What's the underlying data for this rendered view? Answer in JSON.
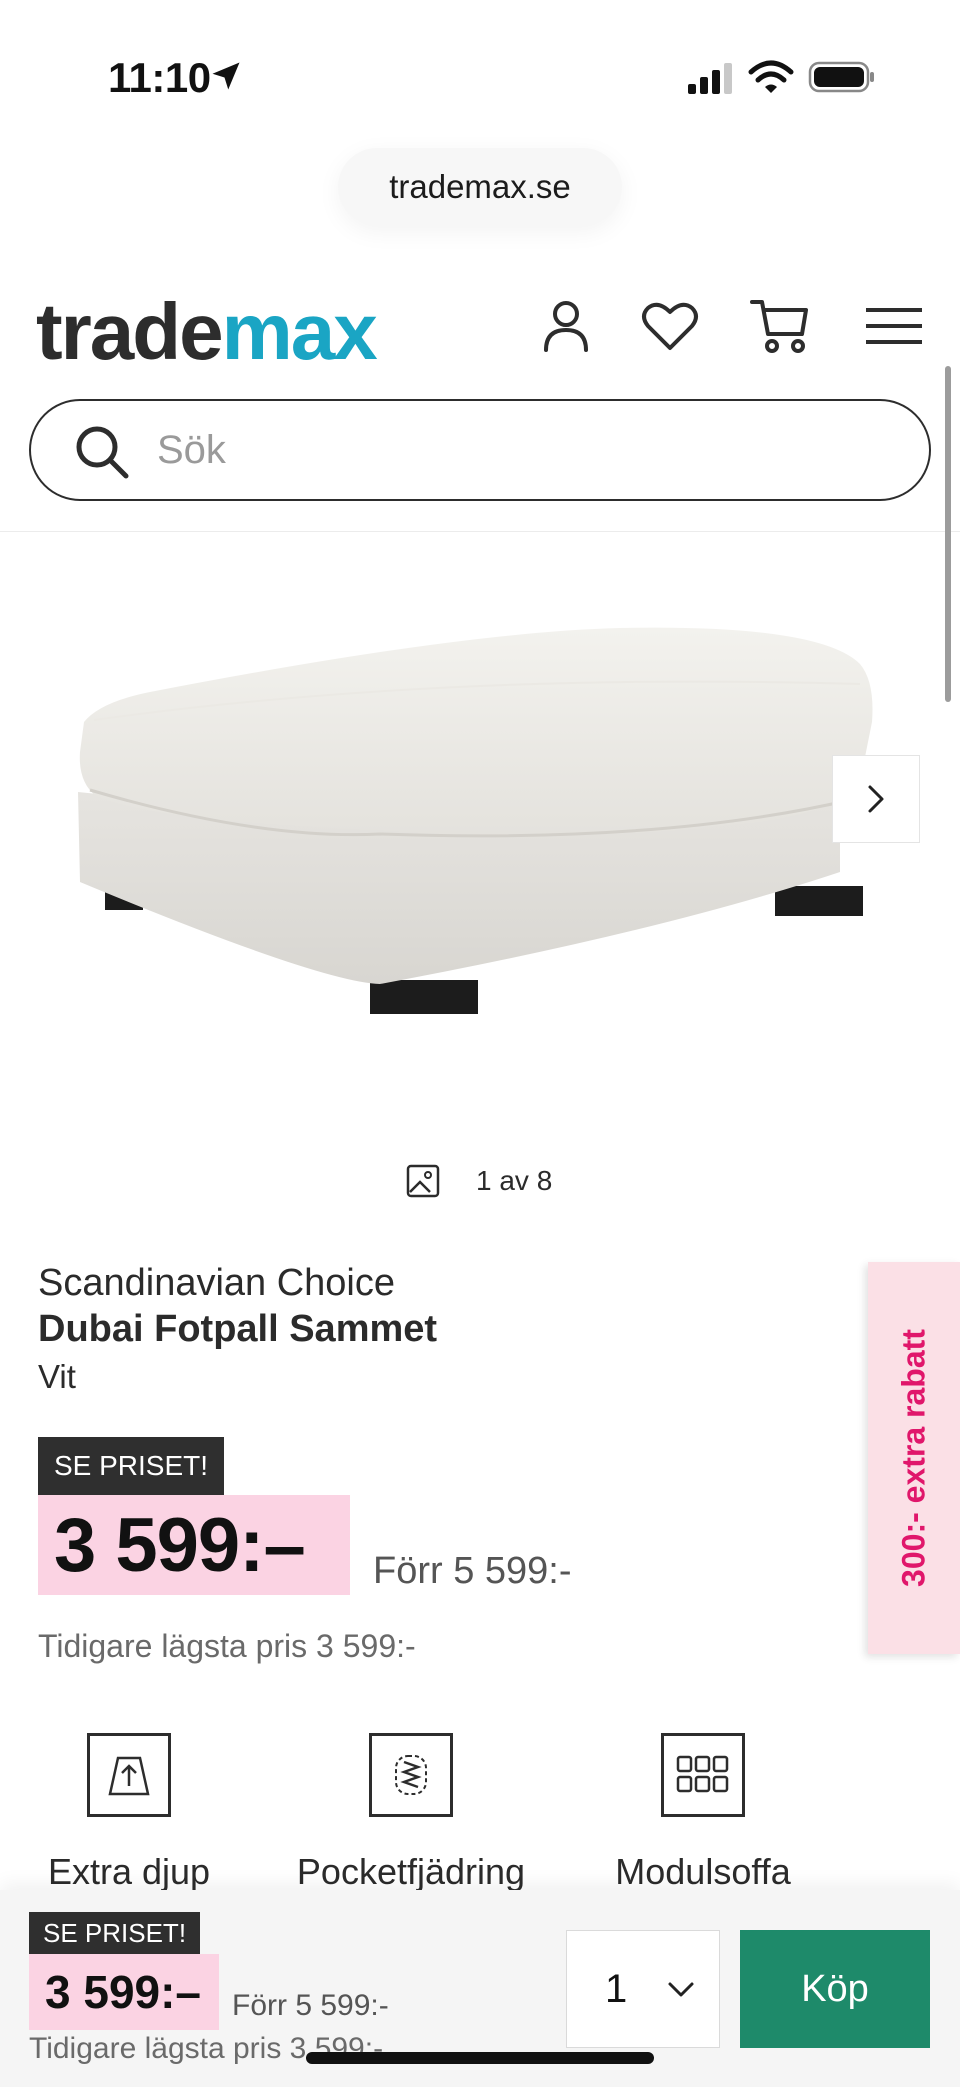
{
  "status_bar": {
    "time": "11:10"
  },
  "browser": {
    "url": "trademax.se"
  },
  "header": {
    "logo_part1": "trade",
    "logo_part2": "max",
    "icons": [
      "account-icon",
      "heart-icon",
      "cart-icon",
      "menu-icon"
    ]
  },
  "search": {
    "placeholder": "Sök"
  },
  "gallery": {
    "counter": "1 av 8"
  },
  "product": {
    "brand": "Scandinavian Choice",
    "name": "Dubai Fotpall Sammet",
    "variant": "Vit",
    "badge": "SE PRISET!",
    "price": "3 599:–",
    "old_price": "Förr 5 599:-",
    "lowest_price": "Tidigare lägsta pris 3 599:-"
  },
  "promo_tab": {
    "label": "300:- extra rabatt"
  },
  "features": [
    {
      "label": "Extra djup",
      "icon": "extra-depth-icon"
    },
    {
      "label": "Pocketfjädring",
      "icon": "pocket-spring-icon"
    },
    {
      "label": "Modulsoffa",
      "icon": "modular-sofa-icon"
    }
  ],
  "footer": {
    "badge": "SE PRISET!",
    "price": "3 599:–",
    "old_price": "Förr 5 599:-",
    "lowest_price": "Tidigare lägsta pris 3 599:-",
    "quantity": "1",
    "buy_label": "Köp"
  },
  "colors": {
    "brand_blue": "#1aa5c4",
    "price_pink": "#fbd3e3",
    "promo_pink": "#e0176b",
    "buy_green": "#1e8a6a"
  }
}
